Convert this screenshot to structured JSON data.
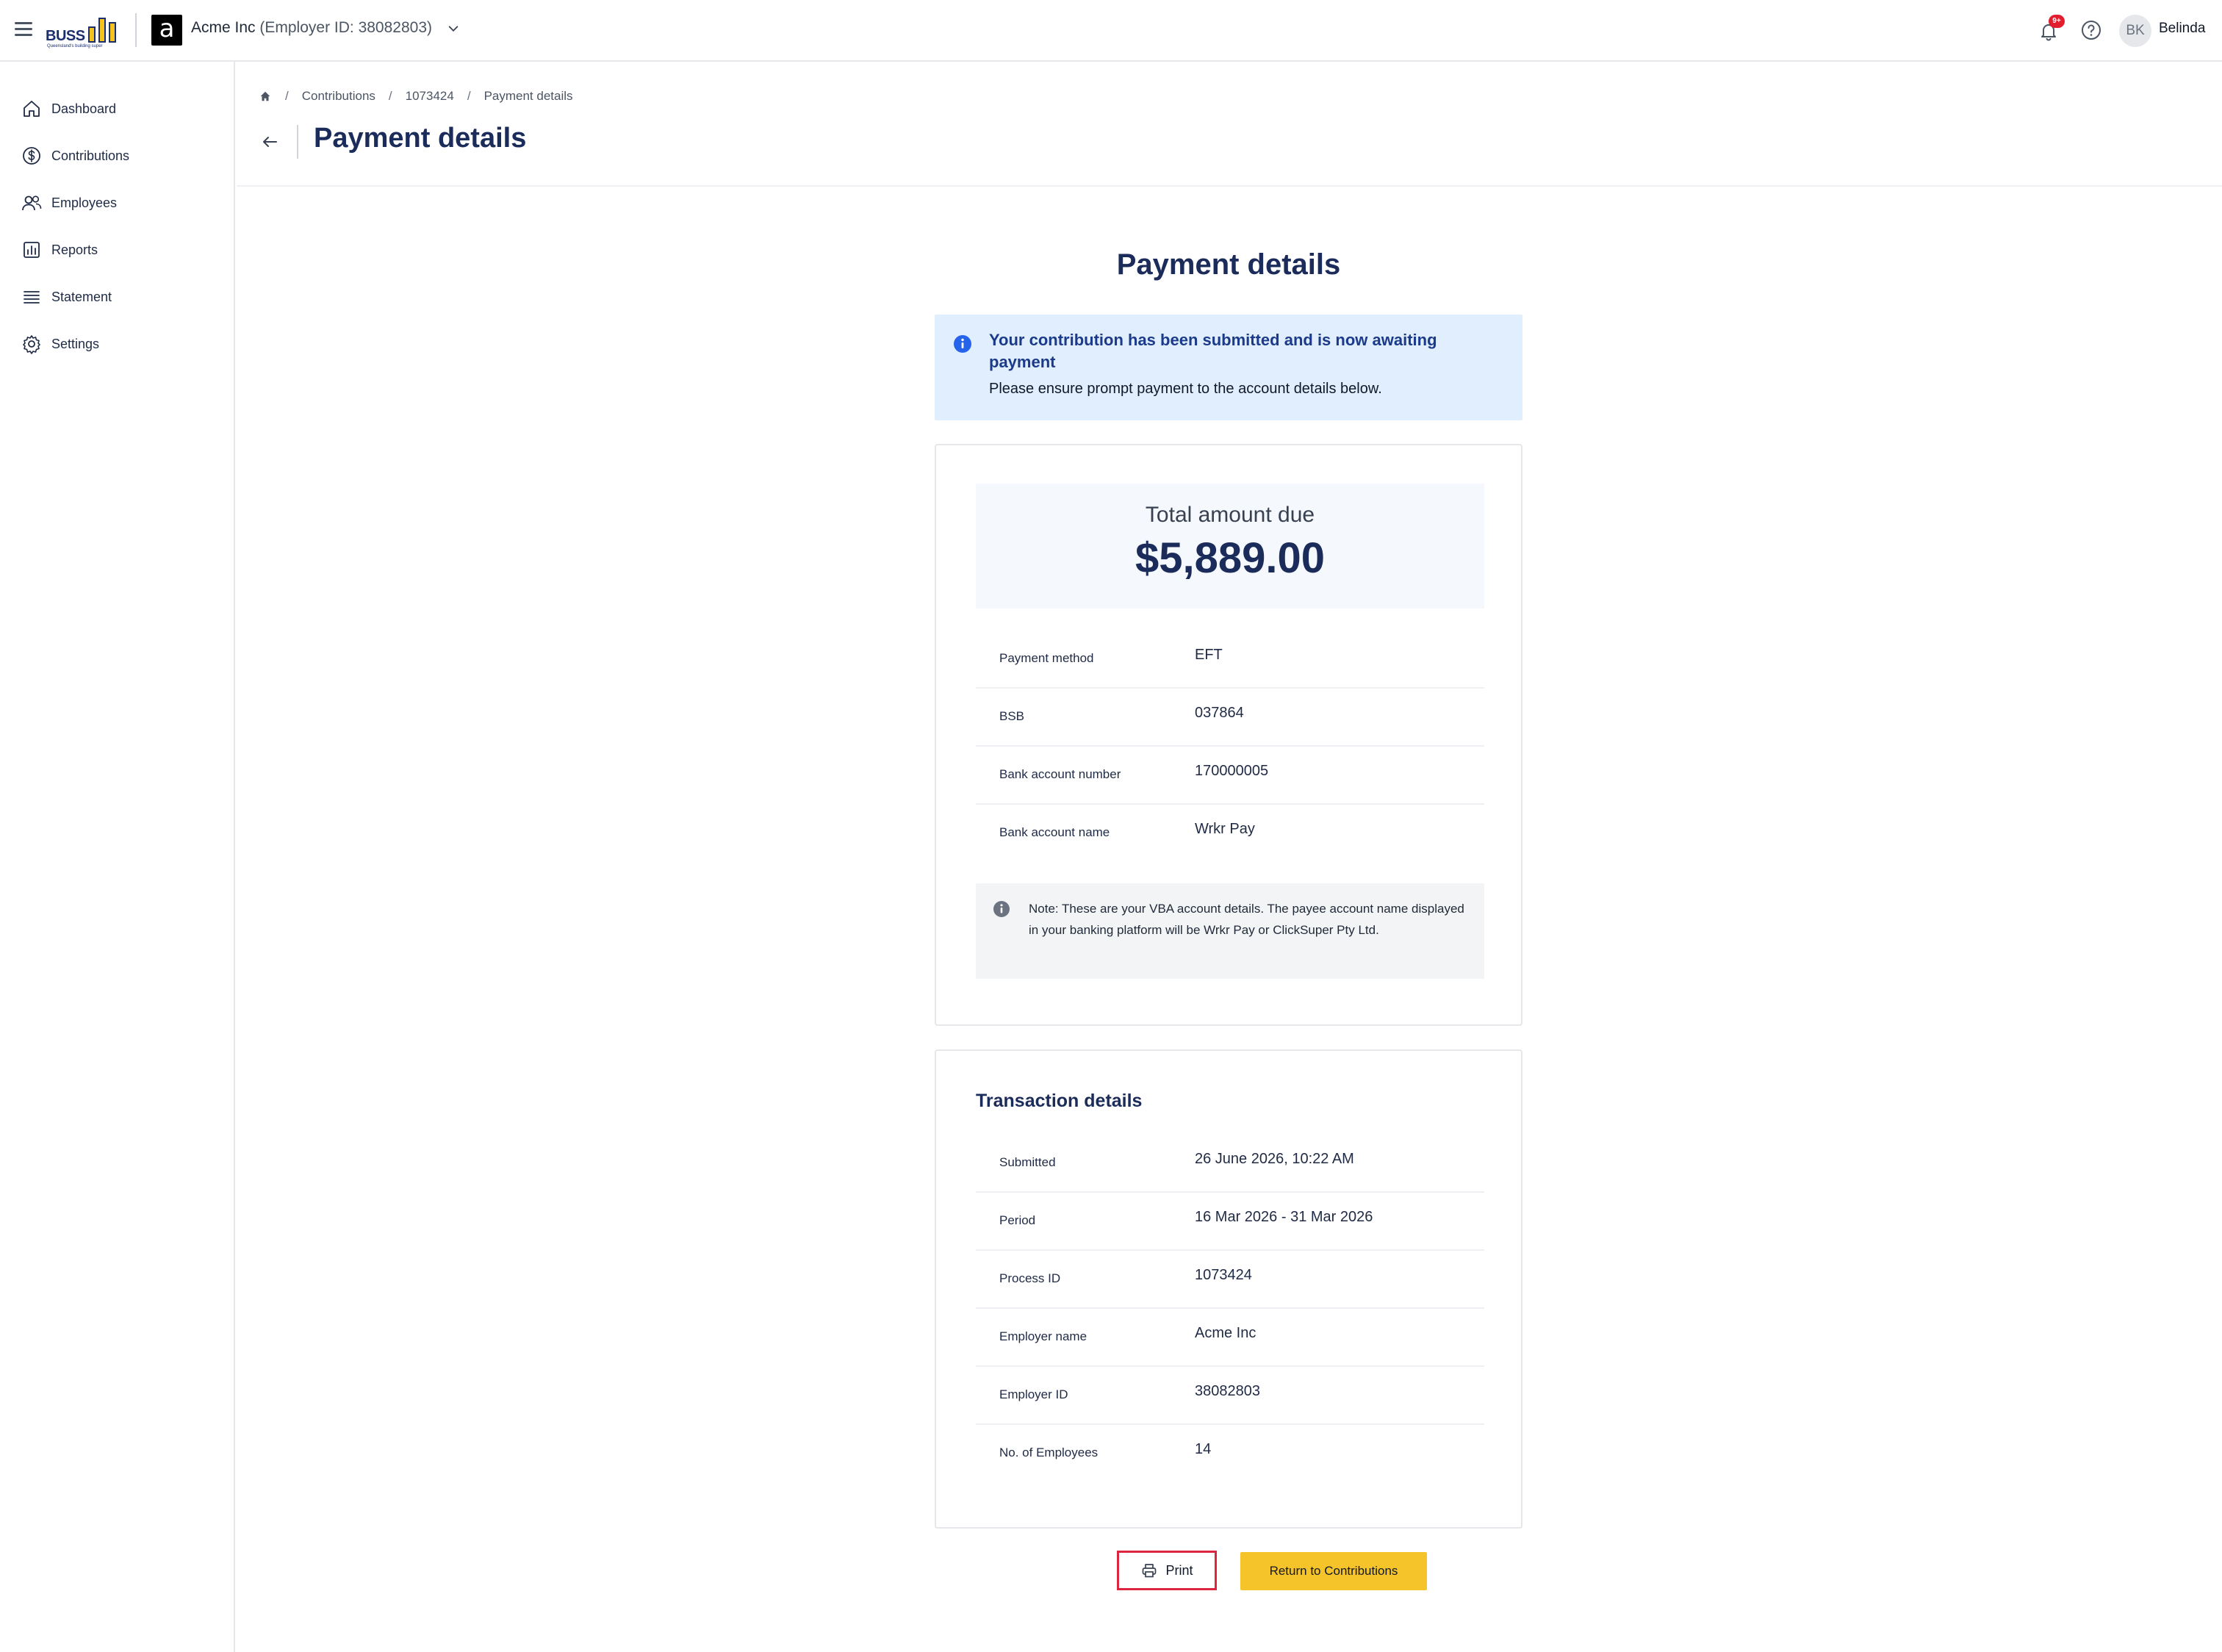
{
  "topbar": {
    "logo_text": "BUSS",
    "logo_tagline": "Queensland's building super",
    "org_initial": "a",
    "org_name": "Acme Inc",
    "org_id_text": "(Employer ID: 38082803)",
    "notification_badge": "9+",
    "user_initials": "BK",
    "user_name": "Belinda"
  },
  "sidebar": {
    "items": [
      {
        "label": "Dashboard",
        "icon": "home-icon"
      },
      {
        "label": "Contributions",
        "icon": "dollar-circle-icon"
      },
      {
        "label": "Employees",
        "icon": "users-icon"
      },
      {
        "label": "Reports",
        "icon": "bar-chart-icon"
      },
      {
        "label": "Statement",
        "icon": "list-icon"
      },
      {
        "label": "Settings",
        "icon": "gear-icon"
      }
    ]
  },
  "breadcrumb": {
    "items": [
      "Contributions",
      "1073424",
      "Payment details"
    ]
  },
  "page": {
    "title": "Payment details",
    "content_title": "Payment details"
  },
  "alert": {
    "title": "Your contribution has been submitted and is now awaiting payment",
    "body": "Please ensure prompt payment to the account details below."
  },
  "payment": {
    "total_label": "Total amount due",
    "total_value": "$5,889.00",
    "rows": [
      {
        "label": "Payment method",
        "value": "EFT"
      },
      {
        "label": "BSB",
        "value": "037864"
      },
      {
        "label": "Bank account number",
        "value": "170000005"
      },
      {
        "label": "Bank account name",
        "value": "Wrkr Pay"
      }
    ],
    "note": "Note: These are your VBA account details. The payee account name displayed in your banking platform will be Wrkr Pay or ClickSuper Pty Ltd."
  },
  "transaction": {
    "title": "Transaction details",
    "rows": [
      {
        "label": "Submitted",
        "value": "26 June 2026, 10:22 AM"
      },
      {
        "label": "Period",
        "value": "16 Mar 2026 - 31 Mar 2026"
      },
      {
        "label": "Process ID",
        "value": "1073424"
      },
      {
        "label": "Employer name",
        "value": "Acme Inc"
      },
      {
        "label": "Employer ID",
        "value": "38082803"
      },
      {
        "label": "No. of Employees",
        "value": "14"
      }
    ]
  },
  "actions": {
    "print_label": "Print",
    "return_label": "Return to Contributions"
  },
  "colors": {
    "brand_navy": "#1b2b5a",
    "brand_yellow": "#f5c42a",
    "alert_bg": "#e0eefe",
    "highlight_red": "#dc2640"
  }
}
